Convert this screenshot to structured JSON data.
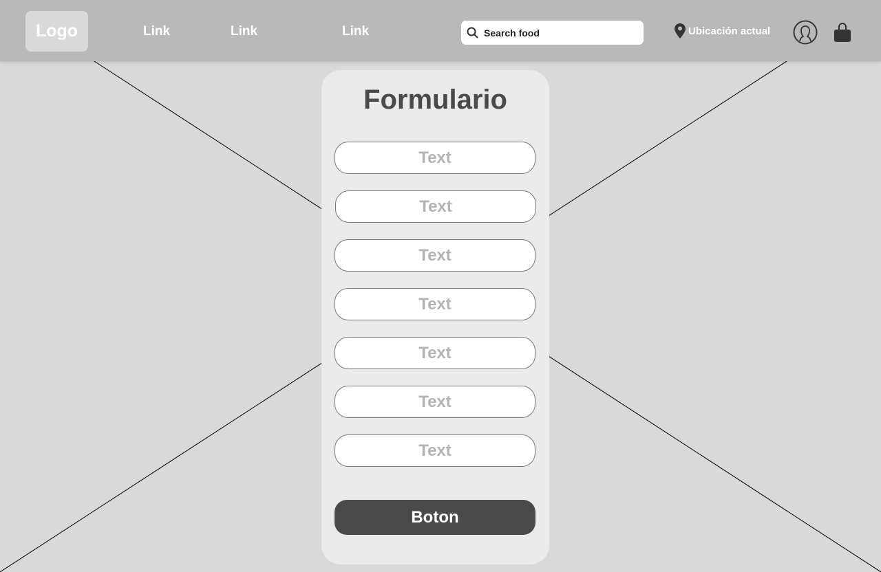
{
  "header": {
    "logo": "Logo",
    "links": [
      "Link",
      "Link",
      "Link"
    ],
    "search_placeholder": "Search food",
    "location": "Ubicación actual"
  },
  "form": {
    "title": "Formulario",
    "fields": [
      "Text",
      "Text",
      "Text",
      "Text",
      "Text",
      "Text",
      "Text"
    ],
    "button": "Boton"
  },
  "colors": {
    "header": "#bab9ba",
    "button": "#4a4a4a",
    "background": "#d9d9d9"
  }
}
